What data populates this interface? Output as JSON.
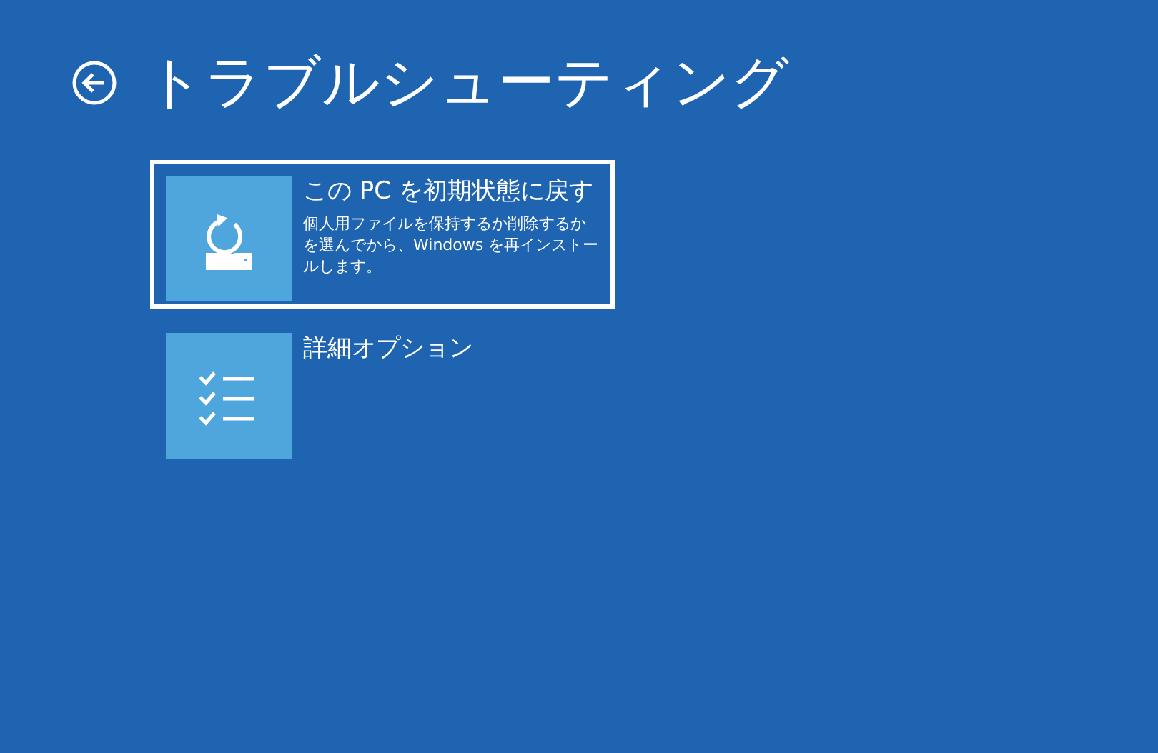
{
  "header": {
    "title": "トラブルシューティング"
  },
  "options": [
    {
      "kind": "reset",
      "title": "この PC を初期状態に戻す",
      "description": "個人用ファイルを保持するか削除するかを選んでから、Windows を再インストールします。",
      "selected": true
    },
    {
      "kind": "advanced",
      "title": "詳細オプション",
      "selected": false
    }
  ]
}
